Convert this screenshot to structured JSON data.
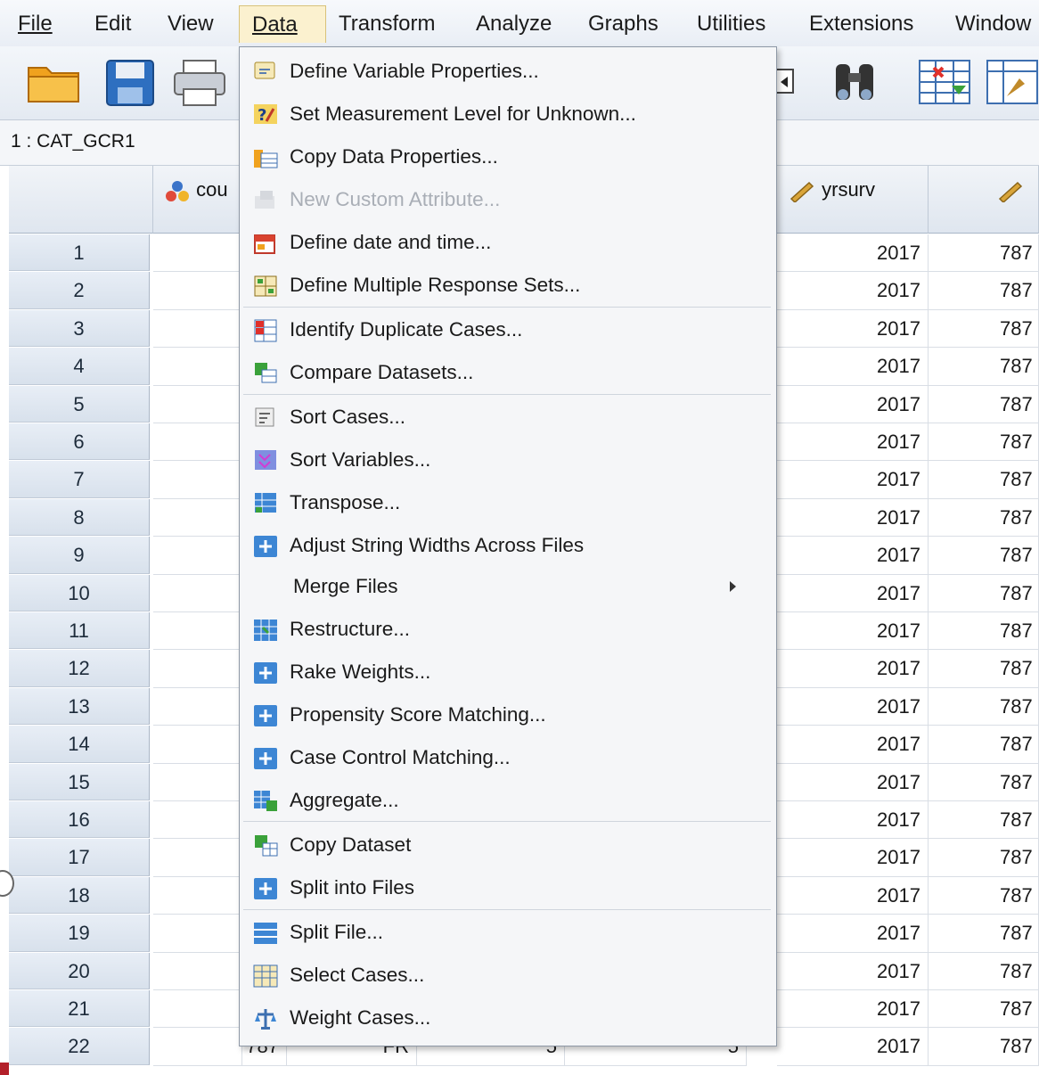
{
  "menubar": {
    "items": [
      {
        "id": "file",
        "label": "File"
      },
      {
        "id": "edit",
        "label": "Edit"
      },
      {
        "id": "view",
        "label": "View"
      },
      {
        "id": "data",
        "label": "Data"
      },
      {
        "id": "transform",
        "label": "Transform"
      },
      {
        "id": "analyze",
        "label": "Analyze"
      },
      {
        "id": "graphs",
        "label": "Graphs"
      },
      {
        "id": "utilities",
        "label": "Utilities"
      },
      {
        "id": "extensions",
        "label": "Extensions"
      },
      {
        "id": "window",
        "label": "Window"
      }
    ]
  },
  "cell_reference": "1 : CAT_GCR1",
  "columns": {
    "col1_name": "cou",
    "col2_name": "yrsurv"
  },
  "rows": {
    "numbers": [
      "1",
      "2",
      "3",
      "4",
      "5",
      "6",
      "7",
      "8",
      "9",
      "10",
      "11",
      "12",
      "13",
      "14",
      "15",
      "16",
      "17",
      "18",
      "19",
      "20",
      "21",
      "22"
    ],
    "yrsurv": "2017",
    "last_col_value": "787",
    "row22_fragments": [
      "787",
      "FR",
      "5",
      "5"
    ]
  },
  "data_menu": {
    "items": [
      {
        "label": "Define Variable Properties...",
        "icon": "define-variable-properties-icon"
      },
      {
        "label": "Set Measurement Level for Unknown...",
        "icon": "measurement-level-icon"
      },
      {
        "label": "Copy Data Properties...",
        "icon": "copy-data-properties-icon"
      },
      {
        "label": "New Custom Attribute...",
        "icon": "custom-attribute-icon",
        "disabled": true
      },
      {
        "label": "Define date and time...",
        "icon": "calendar-icon"
      },
      {
        "label": "Define Multiple Response Sets...",
        "icon": "multiple-response-icon"
      },
      {
        "label": "Identify Duplicate Cases...",
        "icon": "duplicate-cases-icon"
      },
      {
        "label": "Compare Datasets...",
        "icon": "compare-datasets-icon"
      },
      {
        "label": "Sort Cases...",
        "icon": "sort-cases-icon"
      },
      {
        "label": "Sort Variables...",
        "icon": "sort-variables-icon"
      },
      {
        "label": "Transpose...",
        "icon": "transpose-icon"
      },
      {
        "label": "Adjust String Widths Across Files",
        "icon": "plus-box-icon"
      },
      {
        "label": "Merge Files",
        "icon": "",
        "submenu": true
      },
      {
        "label": "Restructure...",
        "icon": "restructure-icon"
      },
      {
        "label": "Rake Weights...",
        "icon": "plus-box-icon"
      },
      {
        "label": "Propensity Score Matching...",
        "icon": "plus-box-icon"
      },
      {
        "label": "Case Control Matching...",
        "icon": "plus-box-icon"
      },
      {
        "label": "Aggregate...",
        "icon": "aggregate-icon"
      },
      {
        "label": "Copy Dataset",
        "icon": "copy-dataset-icon"
      },
      {
        "label": "Split into Files",
        "icon": "plus-box-icon"
      },
      {
        "label": "Split File...",
        "icon": "split-file-icon"
      },
      {
        "label": "Select Cases...",
        "icon": "select-cases-icon"
      },
      {
        "label": "Weight Cases...",
        "icon": "weight-cases-icon"
      }
    ]
  },
  "colors": {
    "menu_active_bg": "#fbf1cf",
    "icon_blue": "#3d86d4",
    "disabled_text": "#a9aeb6"
  }
}
